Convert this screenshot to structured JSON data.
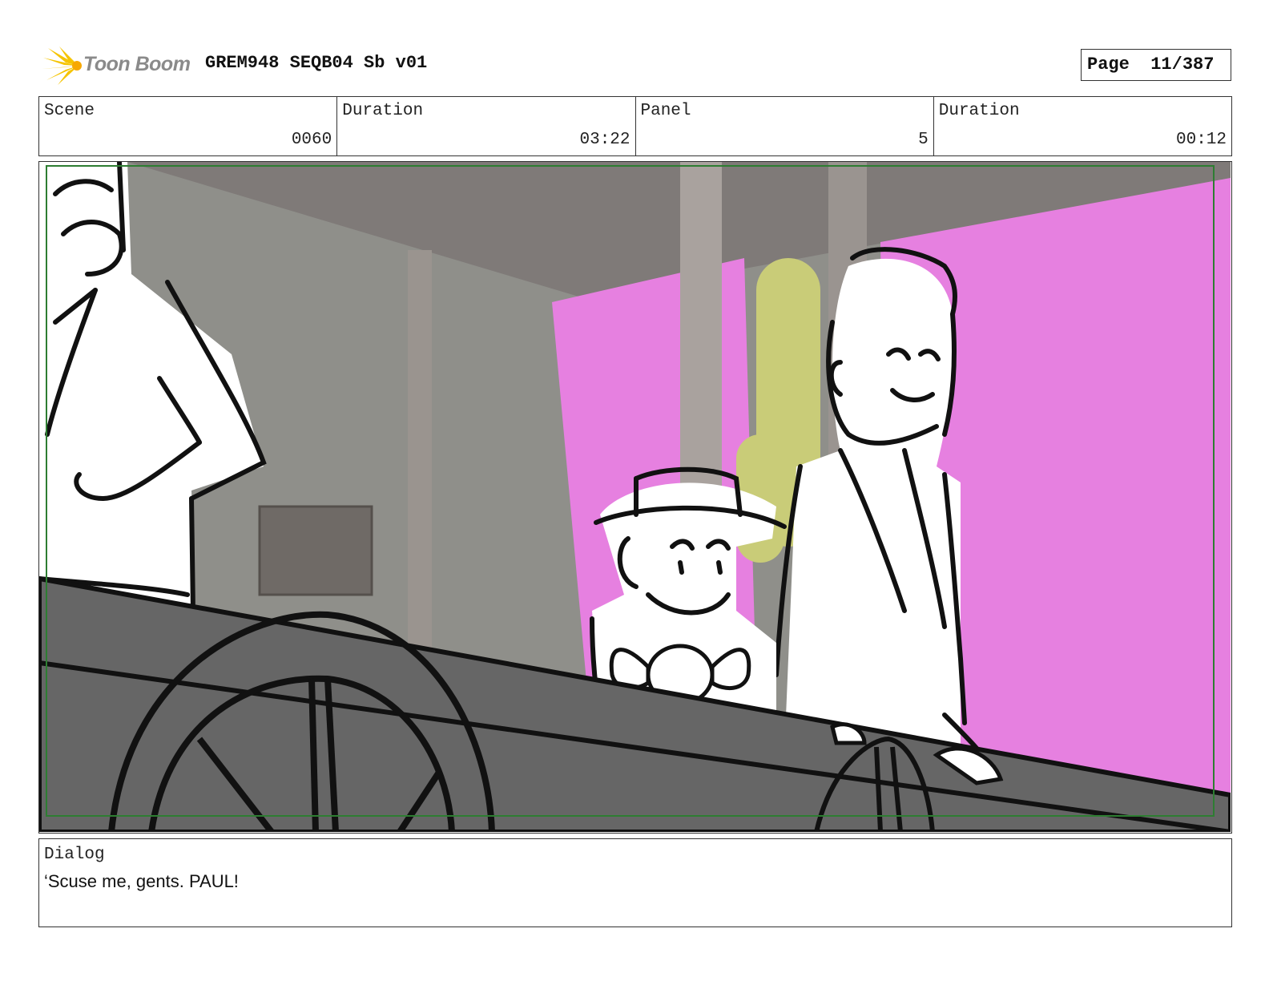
{
  "header": {
    "brand": "Toon Boom",
    "title": "GREM948 SEQB04 Sb v01",
    "page_label": "Page",
    "page_value": "11/387"
  },
  "info": {
    "scene_label": "Scene",
    "scene_value": "0060",
    "scene_duration_label": "Duration",
    "scene_duration_value": "03:22",
    "panel_label": "Panel",
    "panel_value": "5",
    "panel_duration_label": "Duration",
    "panel_duration_value": "00:12"
  },
  "dialog": {
    "label": "Dialog",
    "text": "‘Scuse me, gents. PAUL!"
  },
  "colors": {
    "magenta_bg": "#e680e0",
    "wall_gray": "#8f8f8a",
    "wagon_gray": "#666666",
    "frame_green": "#2e7d32",
    "logo_yellow": "#f5c400"
  }
}
